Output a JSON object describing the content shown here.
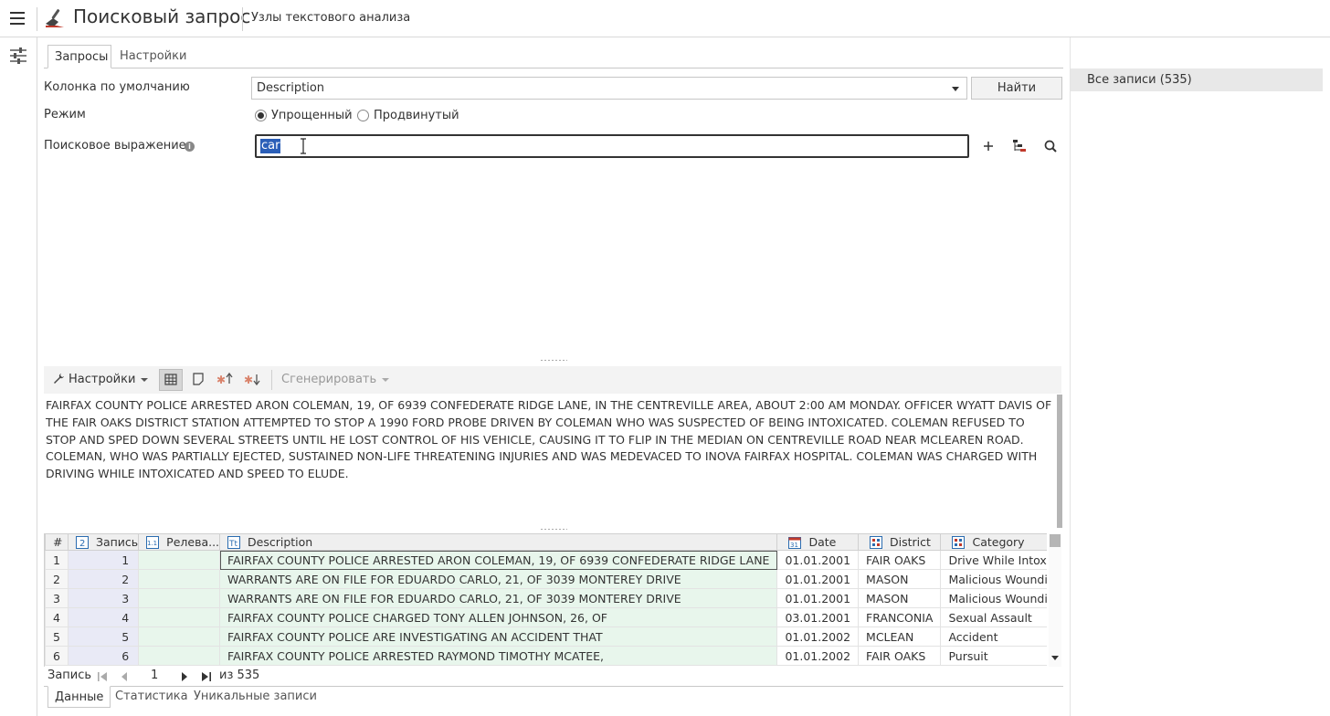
{
  "header": {
    "title": "Поисковый запрос",
    "subtitle": "Узлы текстового анализа"
  },
  "tabs_top": [
    "Запросы",
    "Настройки"
  ],
  "form": {
    "default_column_label": "Колонка по умолчанию",
    "default_column_value": "Description",
    "find_button": "Найти",
    "mode_label": "Режим",
    "mode_simple": "Упрощенный",
    "mode_advanced": "Продвинутый",
    "mode_selected": "Упрощенный",
    "search_label": "Поисковое выражение",
    "search_value": "car"
  },
  "right_panel": {
    "all_records": "Все записи (535)"
  },
  "toolbar": {
    "settings": "Настройки",
    "generate": "Сгенерировать"
  },
  "preview_text": "FAIRFAX COUNTY POLICE ARRESTED ARON COLEMAN, 19, OF 6939 CONFEDERATE RIDGE LANE, IN THE CENTREVILLE AREA, ABOUT 2:00 AM MONDAY. OFFICER WYATT DAVIS OF THE FAIR OAKS DISTRICT STATION ATTEMPTED TO STOP A 1990 FORD PROBE DRIVEN BY COLEMAN WHO WAS SUSPECTED OF BEING INTOXICATED. COLEMAN REFUSED TO STOP AND SPED DOWN SEVERAL STREETS UNTIL HE LOST CONTROL OF HIS VEHICLE, CAUSING IT TO FLIP IN THE MEDIAN ON CENTREVILLE ROAD NEAR MCLEAREN ROAD. COLEMAN, WHO WAS PARTIALLY EJECTED, SUSTAINED NON-LIFE THREATENING INJURIES AND WAS MEDEVACED TO INOVA FAIRFAX HOSPITAL. COLEMAN WAS CHARGED WITH DRIVING WHILE INTOXICATED AND SPEED TO ELUDE.",
  "grid": {
    "columns": [
      "#",
      "Запись",
      "Релева...",
      "Description",
      "Date",
      "District",
      "Category"
    ],
    "rows": [
      [
        "1",
        "1",
        "",
        "FAIRFAX COUNTY POLICE ARRESTED ARON COLEMAN, 19, OF 6939 CONFEDERATE RIDGE LANE",
        "01.01.2001",
        "FAIR OAKS",
        "Drive While Intoxicated"
      ],
      [
        "2",
        "2",
        "",
        "WARRANTS ARE ON FILE FOR EDUARDO CARLO, 21, OF 3039 MONTEREY DRIVE",
        "01.01.2001",
        "MASON",
        "Malicious Wounding"
      ],
      [
        "3",
        "3",
        "",
        "WARRANTS ARE ON FILE FOR EDUARDO CARLO, 21, OF 3039 MONTEREY DRIVE",
        "01.01.2001",
        "MASON",
        "Malicious Wounding"
      ],
      [
        "4",
        "4",
        "",
        "FAIRFAX COUNTY POLICE CHARGED TONY ALLEN JOHNSON, 26, OF",
        "03.01.2001",
        "FRANCONIA",
        "Sexual Assault"
      ],
      [
        "5",
        "5",
        "",
        "FAIRFAX COUNTY POLICE ARE INVESTIGATING AN ACCIDENT THAT",
        "01.01.2002",
        "MCLEAN",
        "Accident"
      ],
      [
        "6",
        "6",
        "",
        "FAIRFAX COUNTY POLICE ARRESTED RAYMOND TIMOTHY MCATEE,",
        "01.01.2002",
        "FAIR OAKS",
        "Pursuit"
      ]
    ]
  },
  "pager": {
    "label": "Запись",
    "page": "1",
    "total": "из 535"
  },
  "tabs_bottom": [
    "Данные",
    "Статистика",
    "Уникальные записи"
  ]
}
